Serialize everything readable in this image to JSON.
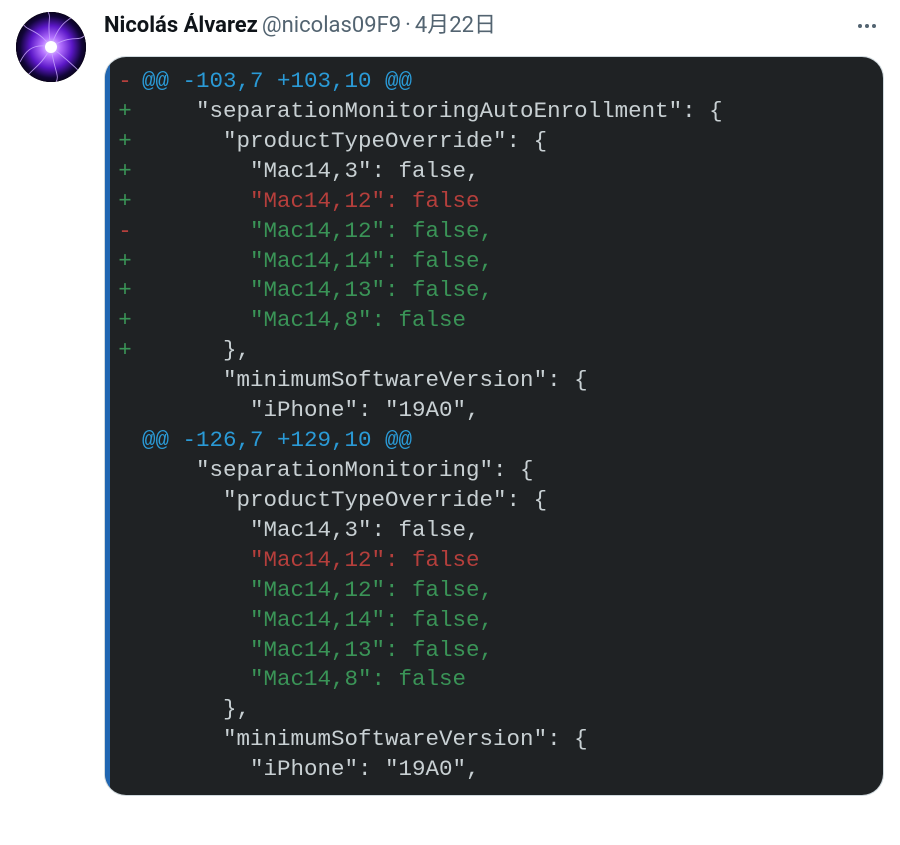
{
  "tweet": {
    "display_name": "Nicolás Álvarez",
    "handle": "@nicolas09F9",
    "separator": "·",
    "date": "4月22日"
  },
  "diff": {
    "lines": [
      {
        "marker": " ",
        "cls": "hunk",
        "indent": 0,
        "text": "@@ -103,7 +103,10 @@"
      },
      {
        "marker": " ",
        "cls": "ctx",
        "indent": 2,
        "text": "\"separationMonitoringAutoEnrollment\": {"
      },
      {
        "marker": " ",
        "cls": "ctx",
        "indent": 3,
        "text": "\"productTypeOverride\": {"
      },
      {
        "marker": " ",
        "cls": "ctx",
        "indent": 4,
        "text": "\"Mac14,3\": false,"
      },
      {
        "marker": "-",
        "cls": "del",
        "indent": 4,
        "text": "\"Mac14,12\": false"
      },
      {
        "marker": "+",
        "cls": "add",
        "indent": 4,
        "text": "\"Mac14,12\": false,"
      },
      {
        "marker": "+",
        "cls": "add",
        "indent": 4,
        "text": "\"Mac14,14\": false,"
      },
      {
        "marker": "+",
        "cls": "add",
        "indent": 4,
        "text": "\"Mac14,13\": false,"
      },
      {
        "marker": "+",
        "cls": "add",
        "indent": 4,
        "text": "\"Mac14,8\": false"
      },
      {
        "marker": " ",
        "cls": "ctx",
        "indent": 3,
        "text": "},"
      },
      {
        "marker": " ",
        "cls": "ctx",
        "indent": 3,
        "text": "\"minimumSoftwareVersion\": {"
      },
      {
        "marker": " ",
        "cls": "ctx",
        "indent": 4,
        "text": "\"iPhone\": \"19A0\","
      },
      {
        "marker": " ",
        "cls": "hunk",
        "indent": 0,
        "text": "@@ -126,7 +129,10 @@"
      },
      {
        "marker": " ",
        "cls": "ctx",
        "indent": 2,
        "text": "\"separationMonitoring\": {"
      },
      {
        "marker": " ",
        "cls": "ctx",
        "indent": 3,
        "text": "\"productTypeOverride\": {"
      },
      {
        "marker": " ",
        "cls": "ctx",
        "indent": 4,
        "text": "\"Mac14,3\": false,"
      },
      {
        "marker": "-",
        "cls": "del",
        "indent": 4,
        "text": "\"Mac14,12\": false"
      },
      {
        "marker": "+",
        "cls": "add",
        "indent": 4,
        "text": "\"Mac14,12\": false,"
      },
      {
        "marker": "+",
        "cls": "add",
        "indent": 4,
        "text": "\"Mac14,14\": false,"
      },
      {
        "marker": "+",
        "cls": "add",
        "indent": 4,
        "text": "\"Mac14,13\": false,"
      },
      {
        "marker": "+",
        "cls": "add",
        "indent": 4,
        "text": "\"Mac14,8\": false"
      },
      {
        "marker": " ",
        "cls": "ctx",
        "indent": 3,
        "text": "},"
      },
      {
        "marker": " ",
        "cls": "ctx",
        "indent": 3,
        "text": "\"minimumSoftwareVersion\": {"
      },
      {
        "marker": " ",
        "cls": "ctx",
        "indent": 4,
        "text": "\"iPhone\": \"19A0\","
      }
    ]
  }
}
